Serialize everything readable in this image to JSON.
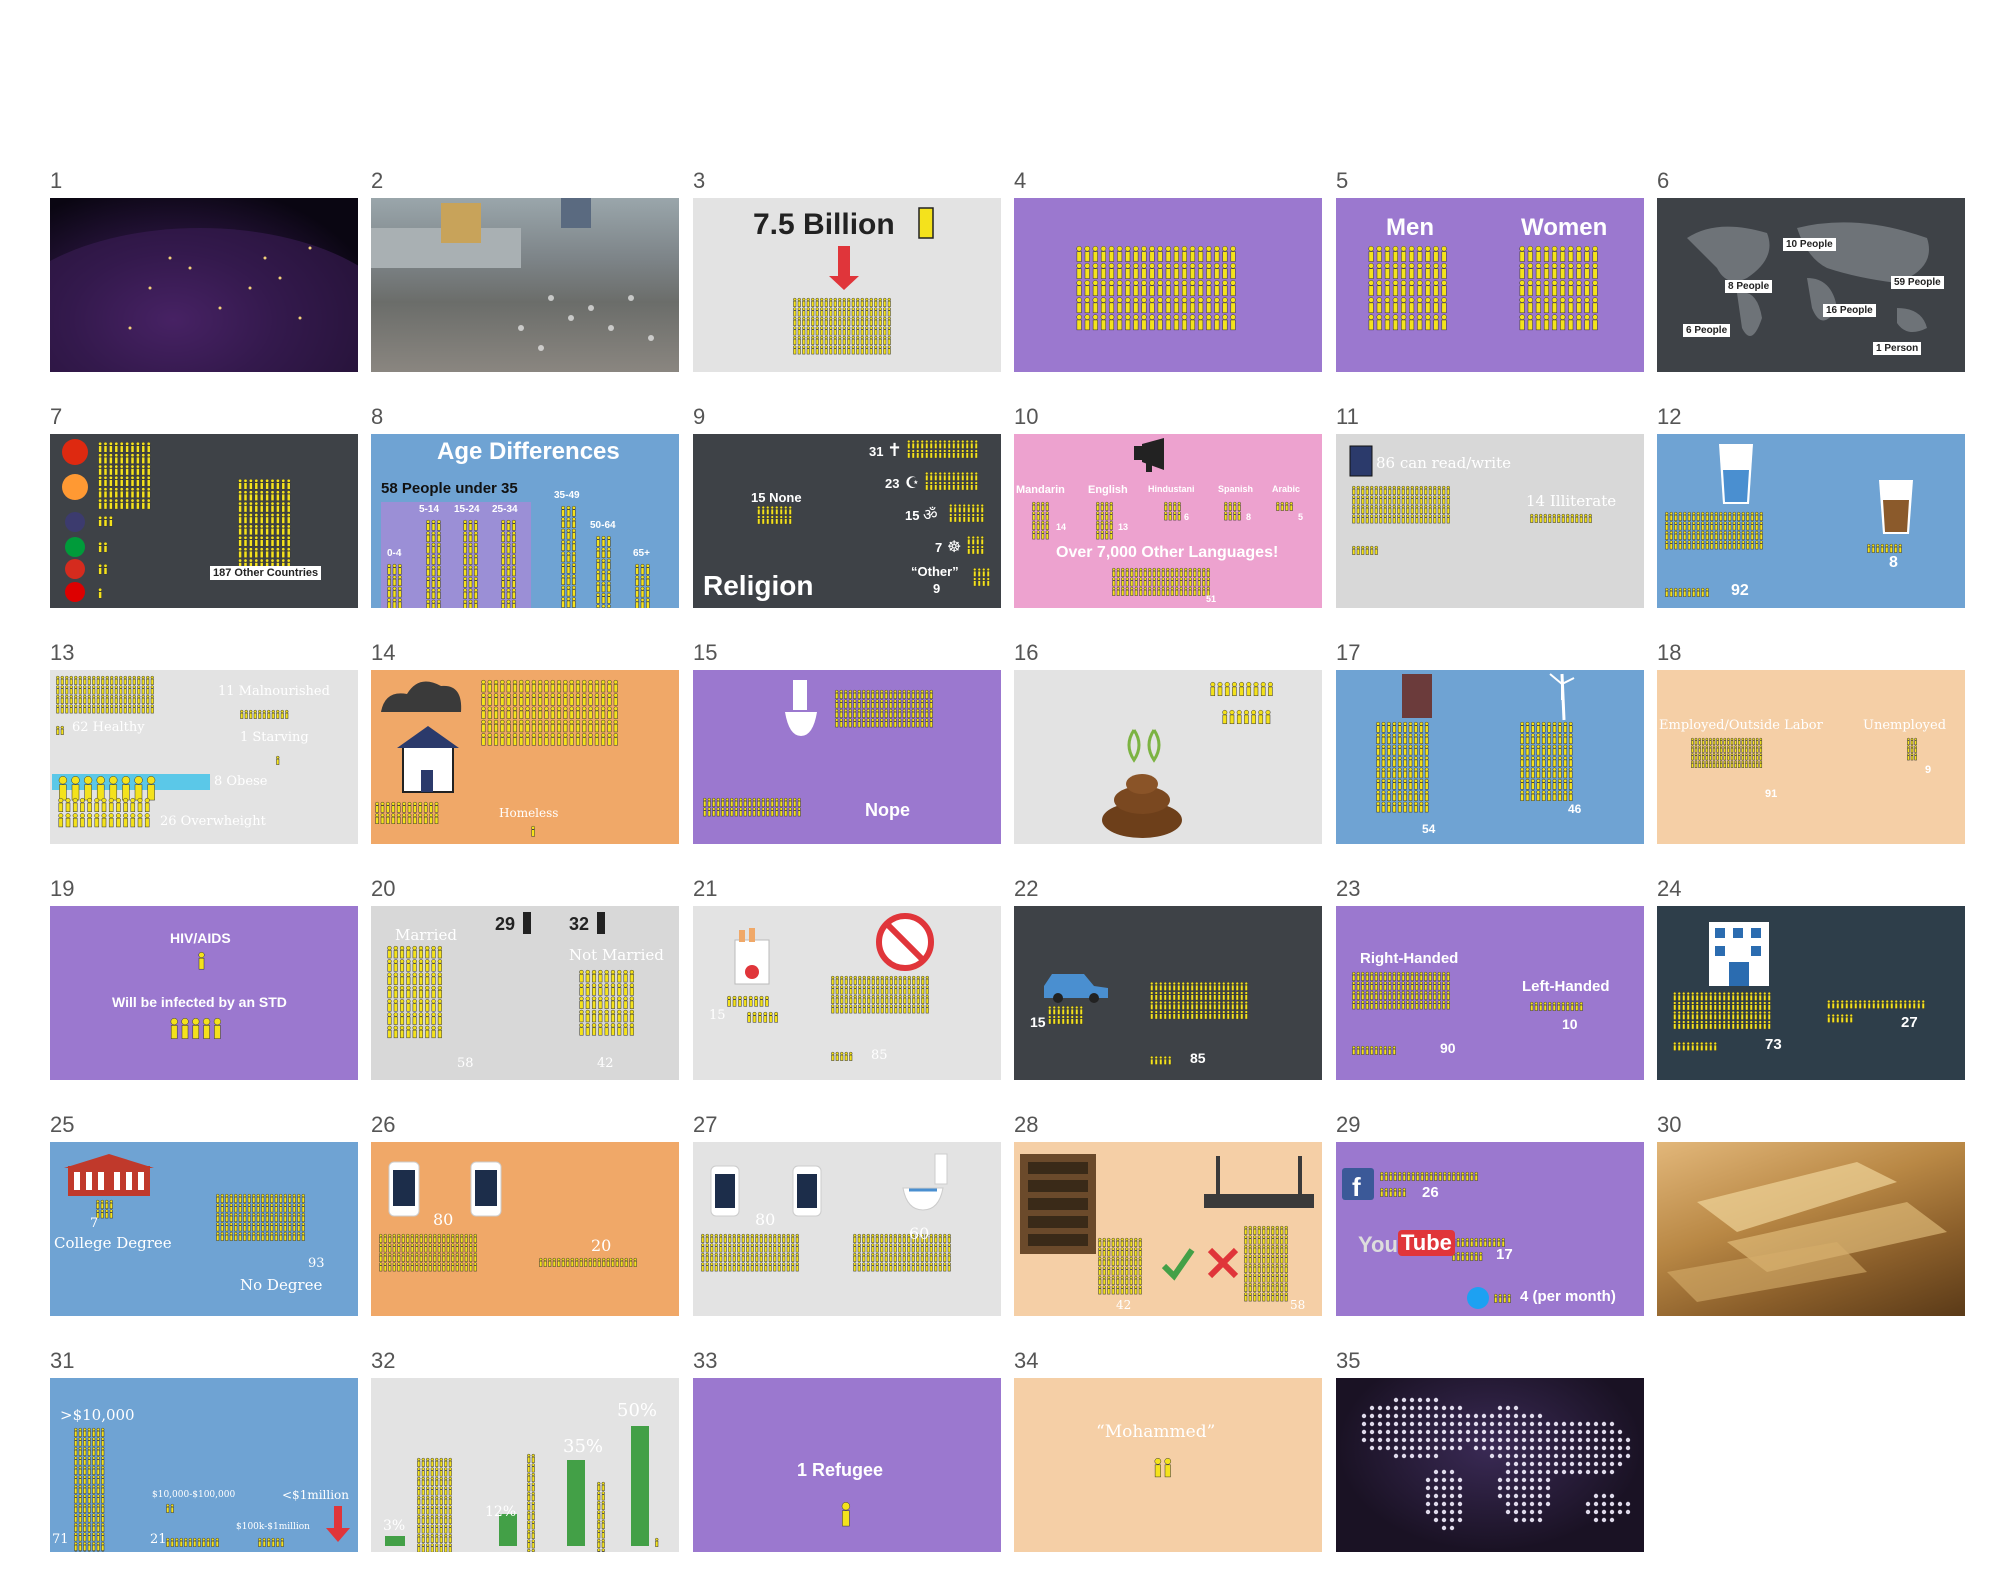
{
  "colors": {
    "purple": "#9b78cf",
    "blue": "#6fa3d3",
    "orange": "#f0a868",
    "peach": "#f5cfa6",
    "pink": "#eda2cf",
    "dark": "#3e4247",
    "gray": "#dcdcdc",
    "person": "#f4e21c",
    "red": "#e0353a"
  },
  "slides": [
    {
      "n": "1"
    },
    {
      "n": "2"
    },
    {
      "n": "3",
      "title": "7.5 Billion"
    },
    {
      "n": "4"
    },
    {
      "n": "5",
      "men": "Men",
      "women": "Women"
    },
    {
      "n": "6",
      "labels": [
        "10 People",
        "8 People",
        "59 People",
        "16 People",
        "6 People",
        "1 Person"
      ]
    },
    {
      "n": "7",
      "label": "187 Other Countries"
    },
    {
      "n": "8",
      "title": "Age Differences",
      "sub": "58 People under 35",
      "ages": [
        "5-14",
        "15-24",
        "25-34",
        "35-49",
        "0-4",
        "50-64",
        "65+"
      ]
    },
    {
      "n": "9",
      "none": "15 None",
      "title": "Religion",
      "v1": "31",
      "v2": "23",
      "v3": "15",
      "v4": "7",
      "other": "“Other”",
      "v5": "9"
    },
    {
      "n": "10",
      "langs": [
        "Mandarin",
        "English",
        "Hindustani",
        "Spanish",
        "Arabic"
      ],
      "vals": [
        "14",
        "13",
        "6",
        "8",
        "5"
      ],
      "other": "Over 7,000 Other Languages!",
      "v": "51"
    },
    {
      "n": "11",
      "read": "86 can read/write",
      "illiterate": "14 Illiterate"
    },
    {
      "n": "12",
      "v1": "92",
      "v2": "8"
    },
    {
      "n": "13",
      "l1": "11 Malnourished",
      "l2": "62 Healthy",
      "l3": "1 Starving",
      "l4": "8 Obese",
      "l5": "26 Overwheight"
    },
    {
      "n": "14",
      "label": "Homeless"
    },
    {
      "n": "15",
      "label": "Nope"
    },
    {
      "n": "16"
    },
    {
      "n": "17",
      "v1": "54",
      "v2": "46"
    },
    {
      "n": "18",
      "l1": "Employed/Outside Labor",
      "l2": "Unemployed",
      "v1": "91",
      "v2": "9"
    },
    {
      "n": "19",
      "l1": "HIV/AIDS",
      "l2": "Will be infected by an STD"
    },
    {
      "n": "20",
      "l1": "Married",
      "v1": "29",
      "v2": "32",
      "l2": "Not Married",
      "v3": "58",
      "v4": "42"
    },
    {
      "n": "21",
      "v1": "15",
      "v2": "85"
    },
    {
      "n": "22",
      "v1": "15",
      "v2": "85"
    },
    {
      "n": "23",
      "l1": "Right-Handed",
      "l2": "Left-Handed",
      "v1": "10",
      "v2": "90"
    },
    {
      "n": "24",
      "v1": "27",
      "v2": "73"
    },
    {
      "n": "25",
      "v1": "7",
      "l1": "College Degree",
      "v2": "93",
      "l2": "No Degree"
    },
    {
      "n": "26",
      "v1": "80",
      "v2": "20"
    },
    {
      "n": "27",
      "v1": "80",
      "v2": "60"
    },
    {
      "n": "28",
      "v1": "42",
      "v2": "58"
    },
    {
      "n": "29",
      "v1": "26",
      "yt1": "You",
      "yt2": "Tube",
      "v2": "17",
      "v3": "4 (per month)"
    },
    {
      "n": "30"
    },
    {
      "n": "31",
      "l1": ">$10,000",
      "l2": "$10,000-$100,000",
      "l3": "<$1million",
      "l4": "$100k-$1million",
      "v1": "71",
      "v2": "21"
    },
    {
      "n": "32",
      "p1": "50%",
      "p2": "35%",
      "p3": "12%",
      "p4": "3%"
    },
    {
      "n": "33",
      "label": "1 Refugee"
    },
    {
      "n": "34",
      "label": "“Mohammed”"
    },
    {
      "n": "35"
    }
  ]
}
